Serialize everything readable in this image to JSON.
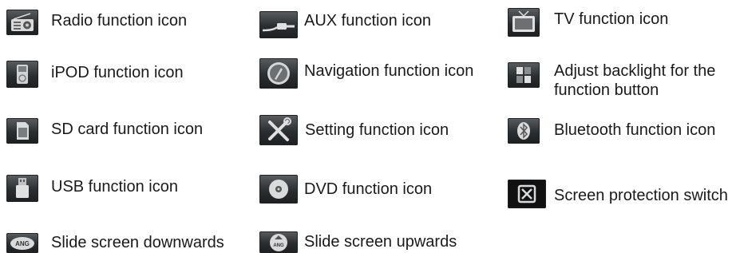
{
  "icons": [
    {
      "icon": "radio-icon",
      "label": "Radio function icon"
    },
    {
      "icon": "aux-icon",
      "label": "AUX function icon"
    },
    {
      "icon": "tv-icon",
      "label": "TV function icon"
    },
    {
      "icon": "ipod-icon",
      "label": "iPOD function icon"
    },
    {
      "icon": "navigation-icon",
      "label": "Navigation function icon"
    },
    {
      "icon": "backlight-icon",
      "label_line1": "Adjust backlight for the",
      "label_line2": "function button"
    },
    {
      "icon": "sd-card-icon",
      "label": "SD card function icon"
    },
    {
      "icon": "setting-icon",
      "label": "Setting function icon"
    },
    {
      "icon": "bluetooth-icon",
      "label": "Bluetooth function icon"
    },
    {
      "icon": "usb-icon",
      "label": "USB function icon"
    },
    {
      "icon": "dvd-icon",
      "label": "DVD function icon"
    },
    {
      "icon": "screen-protection-icon",
      "label": "Screen protection switch"
    },
    {
      "icon": "slide-down-icon",
      "label": "Slide screen downwards",
      "icon_text": "ANG"
    },
    {
      "icon": "slide-up-icon",
      "label": "Slide screen upwards",
      "icon_text": "ANG"
    }
  ]
}
